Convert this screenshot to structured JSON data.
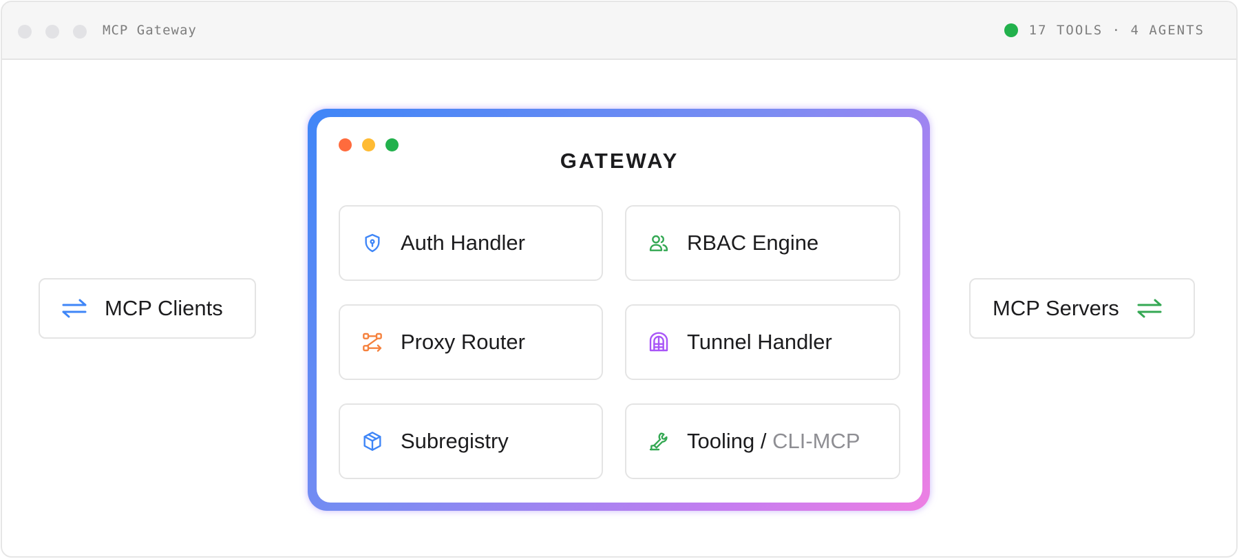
{
  "window": {
    "title": "MCP Gateway",
    "status_text": "17 TOOLS · 4 AGENTS",
    "status_color": "#22b14c"
  },
  "left": {
    "label": "MCP Clients",
    "icon": "arrows-exchange-icon",
    "icon_color": "#3f86f7"
  },
  "right": {
    "label": "MCP Servers",
    "icon": "arrows-exchange-icon",
    "icon_color": "#34a853"
  },
  "gateway": {
    "title": "GATEWAY",
    "dots": [
      "#ff6b3d",
      "#ffbb33",
      "#22b14c"
    ],
    "gradient": [
      "#3f86f7",
      "#ee7fe2"
    ],
    "modules": [
      {
        "label": "Auth Handler",
        "icon": "shield-key-icon",
        "color": "#3f86f7"
      },
      {
        "label": "RBAC Engine",
        "icon": "users-icon",
        "color": "#34a853"
      },
      {
        "label": "Proxy Router",
        "icon": "route-icon",
        "color": "#f5813d"
      },
      {
        "label": "Tunnel Handler",
        "icon": "tunnel-icon",
        "color": "#a855f7"
      },
      {
        "label": "Subregistry",
        "icon": "package-icon",
        "color": "#3f86f7"
      },
      {
        "label": "Tooling",
        "label_separator": " / ",
        "label_muted": "CLI-MCP",
        "icon": "tool-icon",
        "color": "#34a853"
      }
    ]
  }
}
